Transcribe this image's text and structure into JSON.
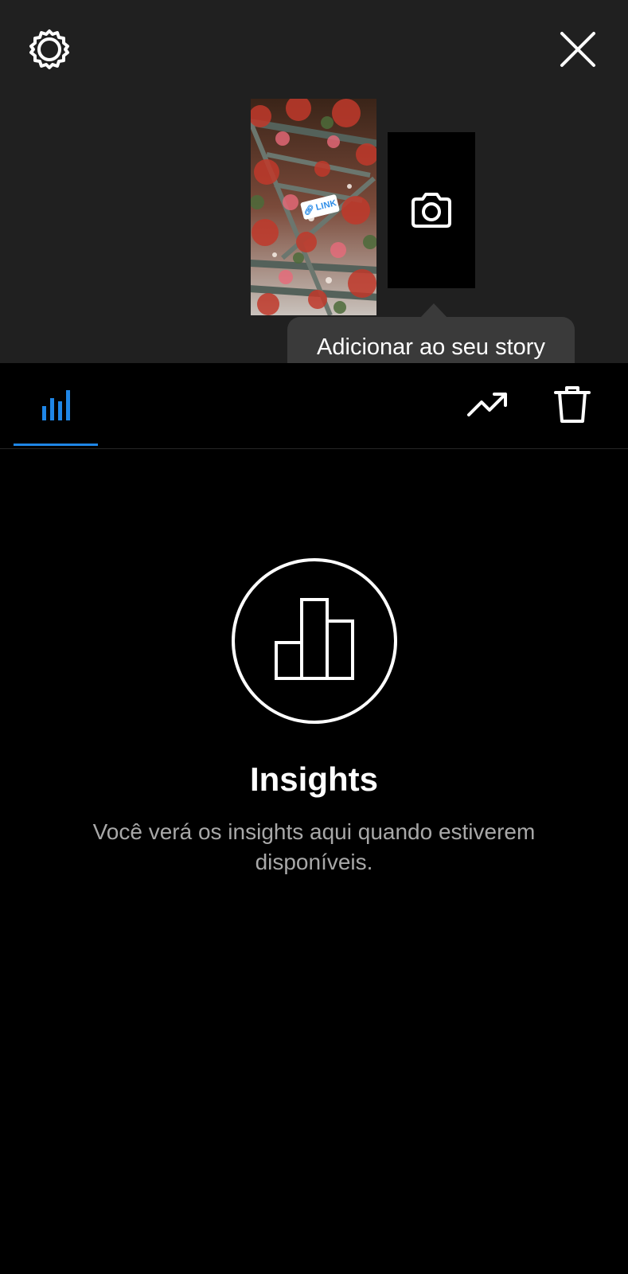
{
  "header": {
    "settings_icon": "gear-icon",
    "close_icon": "close-icon"
  },
  "story": {
    "link_sticker_label": "LINK",
    "add_tile_icon": "camera-icon",
    "tooltip": "Adicionar ao seu story"
  },
  "tabs": {
    "active": "insights",
    "items": [
      {
        "id": "insights",
        "icon": "bar-chart-icon"
      },
      {
        "id": "promote",
        "icon": "trending-up-icon"
      },
      {
        "id": "delete",
        "icon": "trash-icon"
      }
    ],
    "accent_color": "#1f86e6"
  },
  "empty_state": {
    "icon": "insights-chart-icon",
    "title": "Insights",
    "description": "Você verá os insights aqui quando estiverem disponíveis."
  },
  "colors": {
    "background": "#000000",
    "top_area": "#202020",
    "tooltip_bg": "#3a3a3a",
    "muted_text": "#a8a8a8"
  }
}
